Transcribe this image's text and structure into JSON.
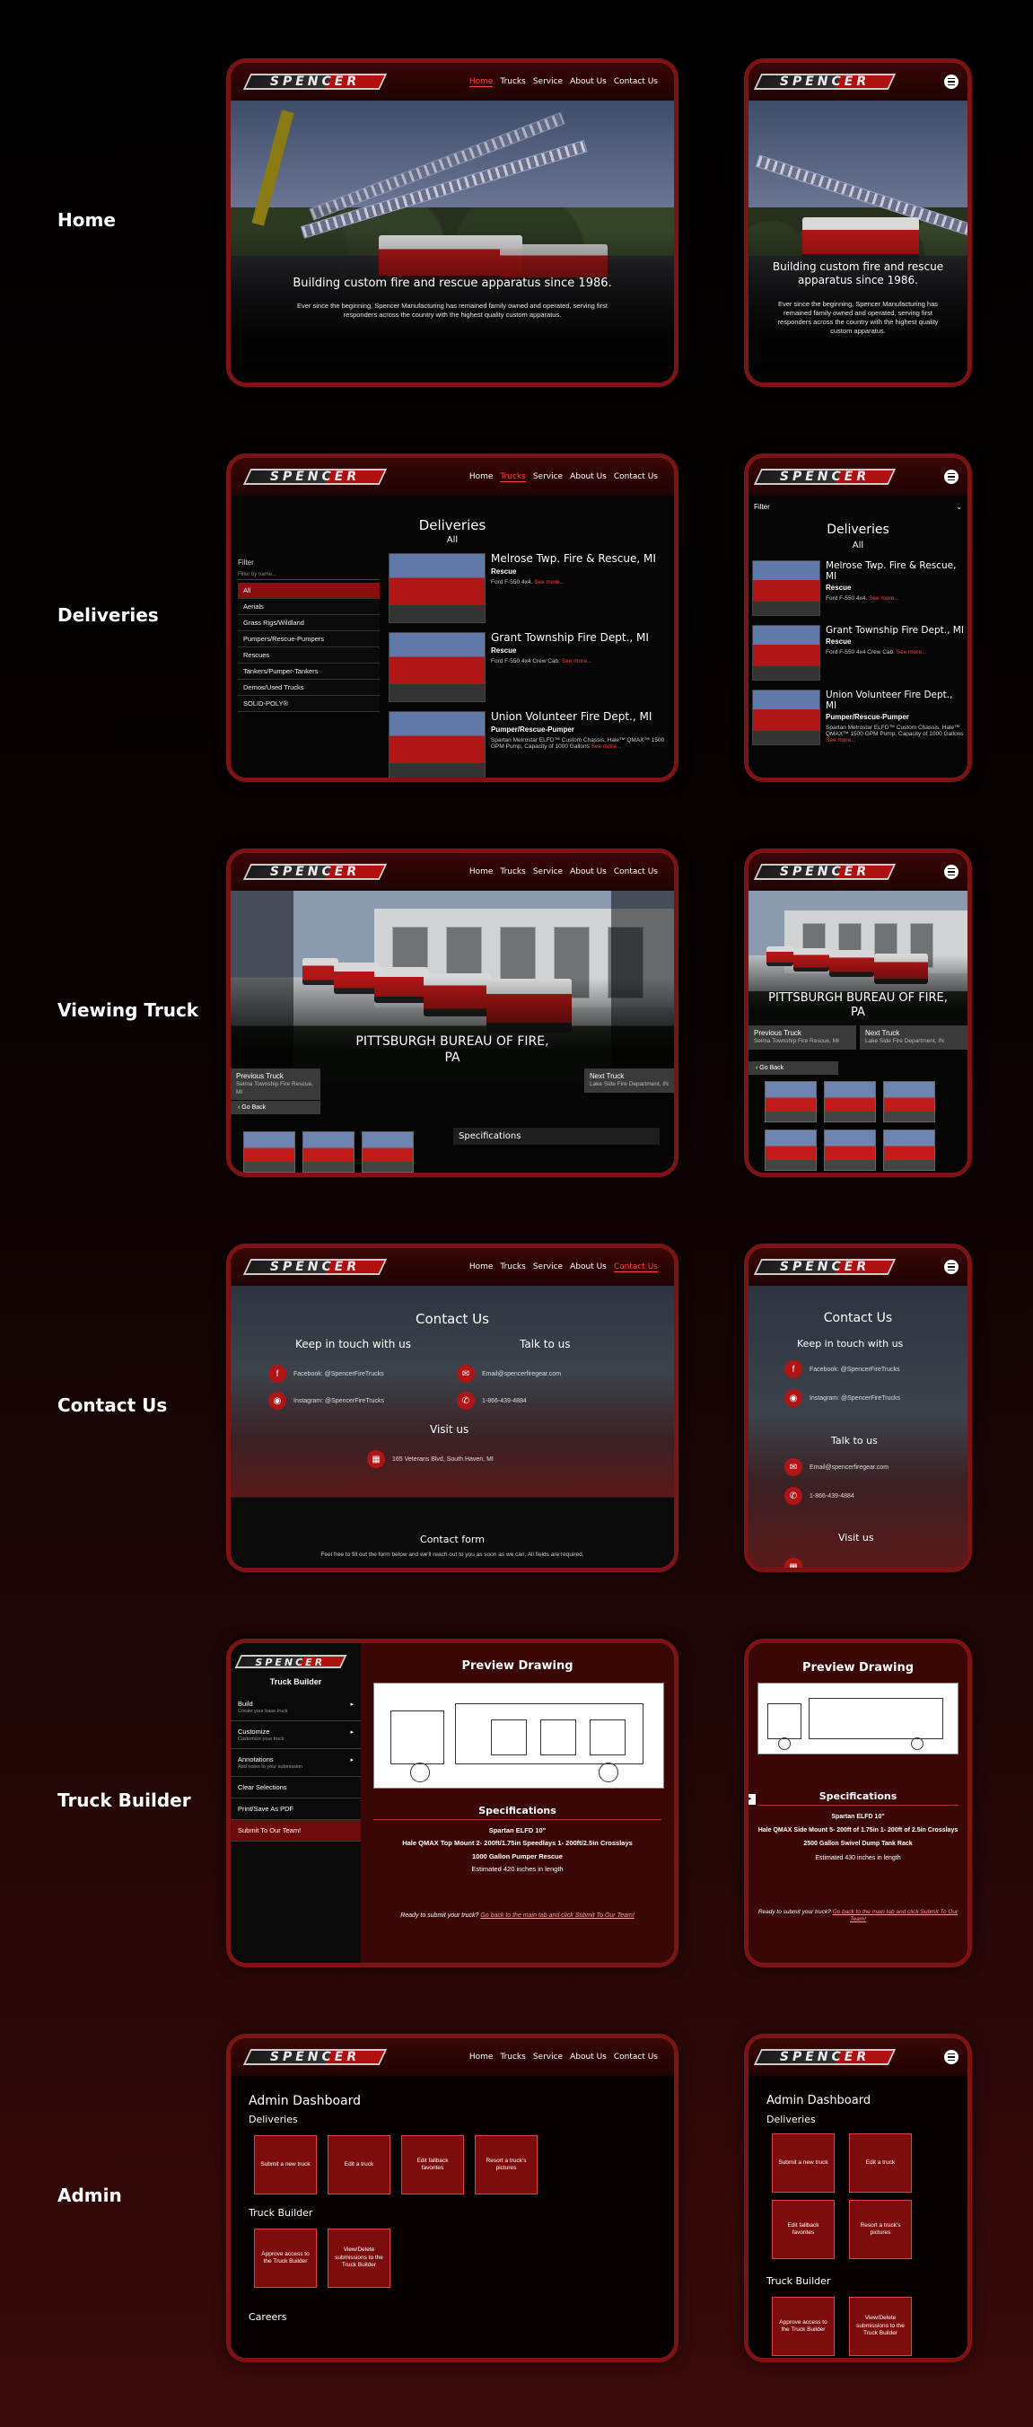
{
  "brand": {
    "logo_text": "SPENCER"
  },
  "nav": {
    "home": "Home",
    "trucks": "Trucks",
    "service": "Service",
    "about": "About Us",
    "contact": "Contact Us"
  },
  "rows": {
    "home": "Home",
    "deliveries": "Deliveries",
    "viewing": "Viewing Truck",
    "contact": "Contact Us",
    "builder": "Truck Builder",
    "admin": "Admin"
  },
  "home": {
    "title": "Building custom fire and rescue apparatus since 1986.",
    "text": "Ever since the beginning, Spencer Manufacturing has remained family owned and operated, serving first responders across the country with the highest quality custom apparatus."
  },
  "deliveries": {
    "title": "Deliveries",
    "subtitle": "All",
    "filter_label": "Filter",
    "filter_placeholder": "Filter by name...",
    "filters": [
      "All",
      "Aerials",
      "Grass Rigs/Wildland",
      "Pumpers/Rescue-Pumpers",
      "Rescues",
      "Tankers/Pumper-Tankers",
      "Demos/Used Trucks",
      "SOLID-POLY®"
    ],
    "items": [
      {
        "name": "Melrose Twp. Fire & Rescue, MI",
        "type": "Rescue",
        "desc": "Ford F-550 4x4.",
        "more": "See more..."
      },
      {
        "name": "Grant Township Fire Dept., MI",
        "type": "Rescue",
        "desc": "Ford F-550 4x4 Crew Cab.",
        "more": "See more..."
      },
      {
        "name": "Union Volunteer Fire Dept., MI",
        "type": "Pumper/Rescue-Pumper",
        "desc": "Spartan Metrostar ELFD™ Custom Chassis, Hale™ QMAX™ 1500 GPM Pump, Capacity of 1000 Gallons",
        "more": "See more..."
      }
    ]
  },
  "viewing": {
    "title": "PITTSBURGH BUREAU OF FIRE, PA",
    "prev_label": "Previous Truck",
    "prev_name": "Selma Township Fire Rescue, MI",
    "next_label": "Next Truck",
    "next_name": "Lake Side Fire Department, IN",
    "back": "Go Back",
    "specs": "Specifications"
  },
  "contact": {
    "title": "Contact Us",
    "keep": "Keep in touch with us",
    "talk": "Talk to us",
    "visit": "Visit us",
    "facebook": "Facebook: @SpencerFireTrucks",
    "instagram": "Instagram: @SpencerFireTrucks",
    "email": "Email@spencerfiregear.com",
    "phone": "1-866-439-4884",
    "address": "165 Veterans Blvd, South Haven, MI",
    "form_title": "Contact form",
    "form_text": "Feel free to fill out the form below and we'll reach out to you as soon as we can. All fields are required."
  },
  "builder": {
    "title": "Truck Builder",
    "preview": "Preview Drawing",
    "specs": "Specifications",
    "menu": [
      {
        "label": "Build",
        "sub": "Create your base truck"
      },
      {
        "label": "Customize",
        "sub": "Customize your truck"
      },
      {
        "label": "Annotations",
        "sub": "Add notes to your submission"
      }
    ],
    "clear": "Clear Selections",
    "print": "Print/Save As PDF",
    "submit": "Submit To Our Team!",
    "tab_specs": [
      "Spartan ELFD 10\"",
      "Hale QMAX Top Mount 2- 200ft/1.75in Speedlays 1- 200ft/2.5in Crosslays",
      "1000 Gallon Pumper Rescue",
      "Estimated 420 inches in length"
    ],
    "mob_specs": [
      "Spartan ELFD 10\"",
      "Hale QMAX Side Mount 5- 200ft of 1.75in 1- 200ft of 2.5in Crosslays",
      "2500 Gallon Swivel Dump Tank Rack",
      "Estimated 430 inches in length"
    ],
    "ready": "Ready to submit your truck?",
    "ready_link": "Go back to the main tab and click Submit To Our Team!"
  },
  "admin": {
    "title": "Admin Dashboard",
    "deliveries": "Deliveries",
    "truck_builder": "Truck Builder",
    "careers": "Careers",
    "tiles_deliveries": [
      "Submit a new truck",
      "Edit a truck",
      "Edit fallback favorites",
      "Resort a truck's pictures"
    ],
    "tiles_builder": [
      "Approve access to the Truck Builder",
      "View/Delete submissions to the Truck Builder"
    ]
  }
}
